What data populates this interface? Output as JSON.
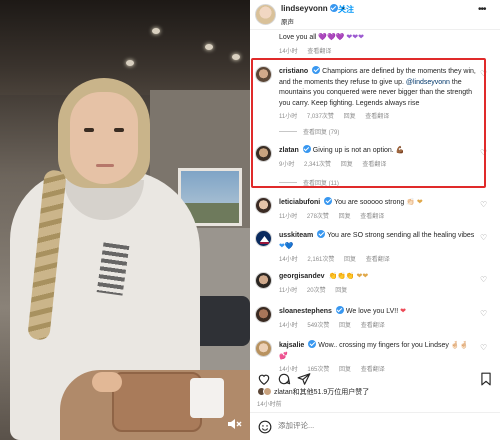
{
  "post": {
    "username": "lindseyvonn",
    "follow_label": "关注",
    "subtitle": "原声"
  },
  "top_comment": {
    "text": "Love you all",
    "emojis": "💜💜💜 ❤❤❤",
    "time": "14小时",
    "translate": "查看翻译"
  },
  "comments": [
    {
      "username": "cristiano",
      "verified": true,
      "text_before": "Champions are defined by the moments they win, and the moments they refuse to give up. ",
      "mention": "@lindseyvonn",
      "text_after": " the mountains you conquered were never bigger than the strength you carry. Keep fighting. Legends always rise",
      "time": "11小时",
      "likes": "7,037次赞",
      "reply": "回复",
      "translate": "查看翻译",
      "view_replies": "查看回复 (79)"
    },
    {
      "username": "zlatan",
      "verified": true,
      "text": "Giving up is not an option.",
      "emoji": "💪🏾",
      "time": "9小时",
      "likes": "2,341次赞",
      "reply": "回复",
      "translate": "查看翻译",
      "view_replies": "查看回复 (11)"
    },
    {
      "username": "leticiabufoni",
      "verified": true,
      "text": "You are sooooo strong",
      "emoji": "👏🏻 ❤",
      "time": "11小时",
      "likes": "278次赞",
      "reply": "回复",
      "translate": "查看翻译"
    },
    {
      "username": "usskiteam",
      "verified": true,
      "text": "You are SO strong sending all the healing vibes",
      "emoji": "❤💙",
      "time": "14小时",
      "likes": "2,161次赞",
      "reply": "回复",
      "translate": "查看翻译"
    },
    {
      "username": "georgisandev",
      "verified": false,
      "text": "",
      "emoji": "👏👏👏 ❤❤",
      "time": "11小时",
      "likes": "20次赞",
      "reply": "回复",
      "translate": ""
    },
    {
      "username": "sloanestephens",
      "verified": true,
      "text": "We love you LV!!",
      "emoji": "❤",
      "time": "14小时",
      "likes": "549次赞",
      "reply": "回复",
      "translate": "查看翻译"
    },
    {
      "username": "kajsalie",
      "verified": true,
      "text": "Wow.. crossing my fingers for you Lindsey",
      "emoji": "🤞🏻🤞🏻 💕",
      "time": "14小时",
      "likes": "165次赞",
      "reply": "回复",
      "translate": "查看翻译"
    }
  ],
  "likes_summary": {
    "text": "zlatan和其他51.9万位用户赞了"
  },
  "post_time": "14小时前",
  "composer": {
    "placeholder": "添加评论..."
  },
  "icons": {
    "like": "heart-icon",
    "comment": "comment-icon",
    "share": "share-icon",
    "save": "bookmark-icon",
    "emoji": "emoji-icon",
    "sound": "sound-off-icon"
  },
  "colors": {
    "highlight": "#e02a2a",
    "verified": "#3897f0",
    "link": "#0095f6",
    "muted": "#8e8e8e"
  }
}
